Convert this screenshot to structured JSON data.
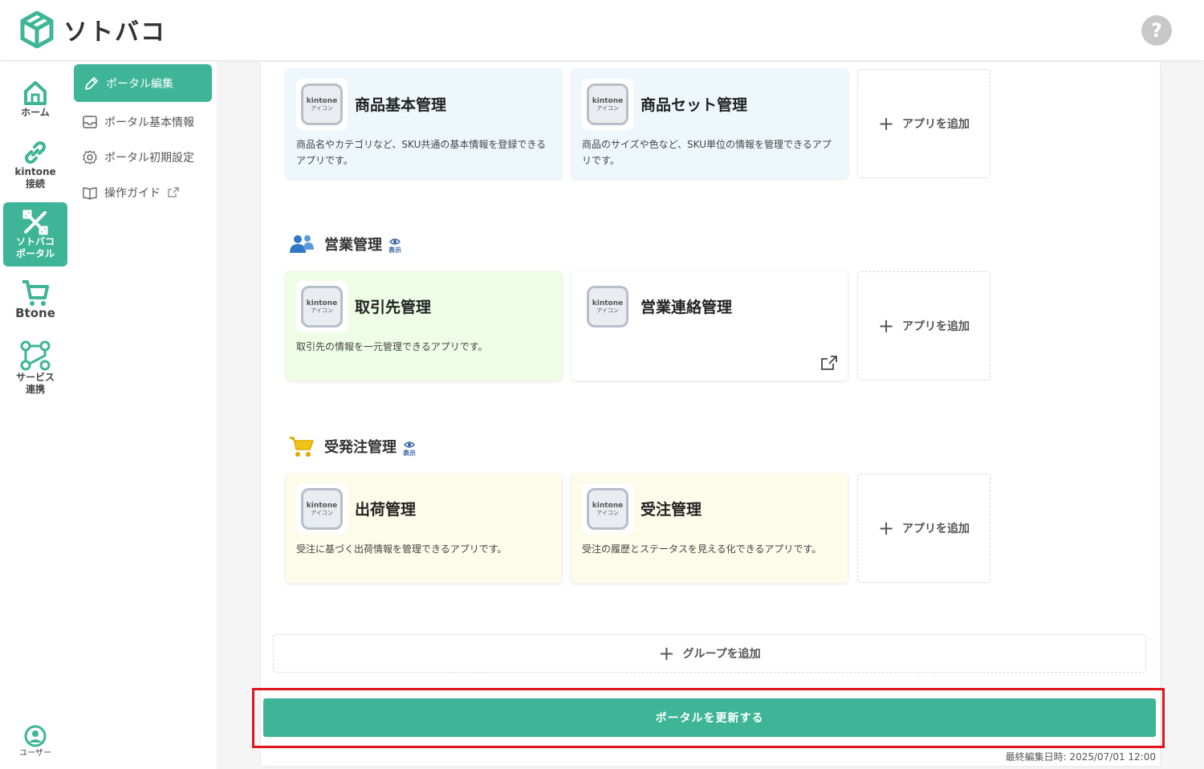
{
  "header": {
    "logo_text": "ソトバコ",
    "help_label": "?"
  },
  "rail": {
    "items": [
      {
        "label": "ホーム",
        "icon": "home-icon"
      },
      {
        "label": "kintone\n接続",
        "icon": "link-icon"
      },
      {
        "label": "ソトバコ\nポータル",
        "icon": "portal-tools-icon",
        "active": true
      },
      {
        "label": "Btone",
        "icon": "cart-icon"
      },
      {
        "label": "サービス\n連携",
        "icon": "service-connect-icon"
      }
    ],
    "user_label": "ユーザー"
  },
  "subnav": {
    "active": "ポータル編集",
    "items": [
      "ポータル基本情報",
      "ポータル初期設定",
      "操作ガイド"
    ]
  },
  "groups": [
    {
      "title": "",
      "apps": [
        {
          "title": "商品基本管理",
          "desc": "商品名やカテゴリなど、SKU共通の基本情報を登録できるアプリです。",
          "color": "blue"
        },
        {
          "title": "商品セット管理",
          "desc": "商品のサイズや色など、SKU単位の情報を管理できるアプリです。",
          "color": "blue"
        }
      ]
    },
    {
      "title": "営業管理",
      "visibility": "表示",
      "apps": [
        {
          "title": "取引先管理",
          "desc": "取引先の情報を一元管理できるアプリです。",
          "color": "green"
        },
        {
          "title": "営業連絡管理",
          "desc": "",
          "color": "white"
        }
      ]
    },
    {
      "title": "受発注管理",
      "visibility": "表示",
      "apps": [
        {
          "title": "出荷管理",
          "desc": "受注に基づく出荷情報を管理できるアプリです。",
          "color": "yellow"
        },
        {
          "title": "受注管理",
          "desc": "受注の履歴とステータスを見える化できるアプリです。",
          "color": "yellow"
        }
      ]
    }
  ],
  "kintone_icon": {
    "top": "kintone",
    "bottom": "アイコン"
  },
  "add_app_label": "アプリを追加",
  "add_group_label": "グループを追加",
  "update_button_label": "ポータルを更新する",
  "last_edited": "最終編集日時: 2025/07/01 12:00",
  "colors": {
    "accent": "#3db596",
    "highlight": "#e0141e"
  }
}
